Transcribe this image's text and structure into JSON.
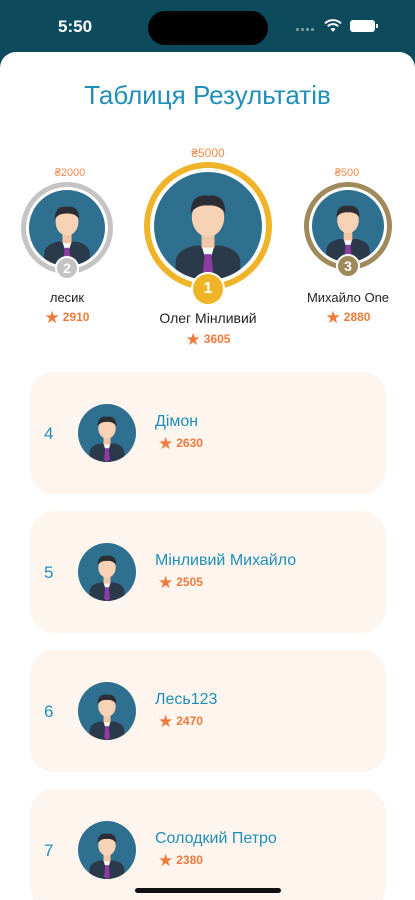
{
  "status": {
    "time": "5:50"
  },
  "title": "Таблиця Результатів",
  "podium": [
    {
      "place": "1",
      "name": "Олег Мінливий",
      "score": "3605",
      "prize": "₴5000"
    },
    {
      "place": "2",
      "name": "лесик",
      "score": "2910",
      "prize": "₴2000"
    },
    {
      "place": "3",
      "name": "Михайло One",
      "score": "2880",
      "prize": "₴500"
    }
  ],
  "rows": [
    {
      "rank": "4",
      "name": "Дімон",
      "score": "2630"
    },
    {
      "rank": "5",
      "name": "Мінливий Михайло",
      "score": "2505"
    },
    {
      "rank": "6",
      "name": "Лесь123",
      "score": "2470"
    },
    {
      "rank": "7",
      "name": "Солодкий Петро",
      "score": "2380"
    }
  ],
  "colors": {
    "accent": "#1f8fb8",
    "star": "#f07a3c",
    "gold": "#f0b429",
    "silver": "#c4c4c4",
    "bronze": "#a08a5c",
    "row_bg": "#fdf5ee"
  },
  "icons": {
    "star": "star-icon",
    "avatar": "user-avatar-icon"
  }
}
